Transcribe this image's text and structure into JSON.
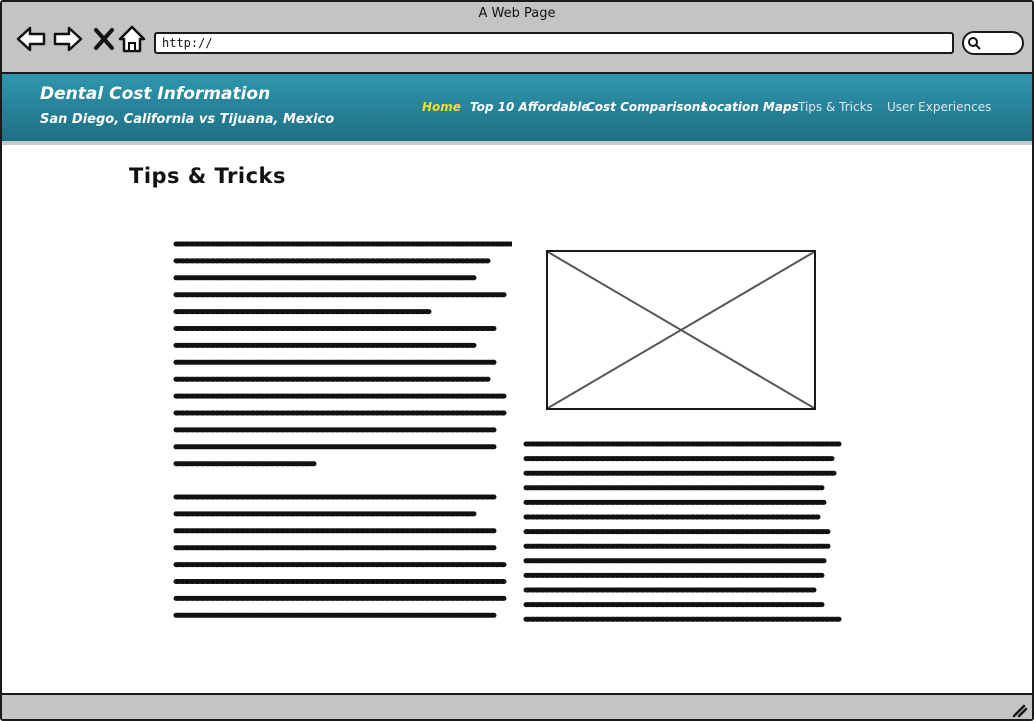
{
  "browser": {
    "window_title": "A Web Page",
    "address_bar_value": "http://",
    "nav_icons": [
      "back-arrow-icon",
      "forward-arrow-icon",
      "close-x-icon",
      "home-icon"
    ],
    "search_icon": "magnifier-icon"
  },
  "site": {
    "title": "Dental Cost Information",
    "subtitle": "San Diego, California vs Tijuana, Mexico",
    "header_color": "#2f97ad",
    "active_nav_color": "#f4e01e",
    "nav": [
      {
        "label": "Home",
        "active": true
      },
      {
        "label": "Top 10 Affordable",
        "active": false
      },
      {
        "label": "Cost Comparisons",
        "active": false
      },
      {
        "label": "Location Maps",
        "active": false
      },
      {
        "label": "Tips & Tricks",
        "active": false
      },
      {
        "label": "User Experiences",
        "active": false
      }
    ]
  },
  "page": {
    "heading": "Tips & Tricks",
    "image_placeholder_icon": "image-placeholder-icon"
  }
}
